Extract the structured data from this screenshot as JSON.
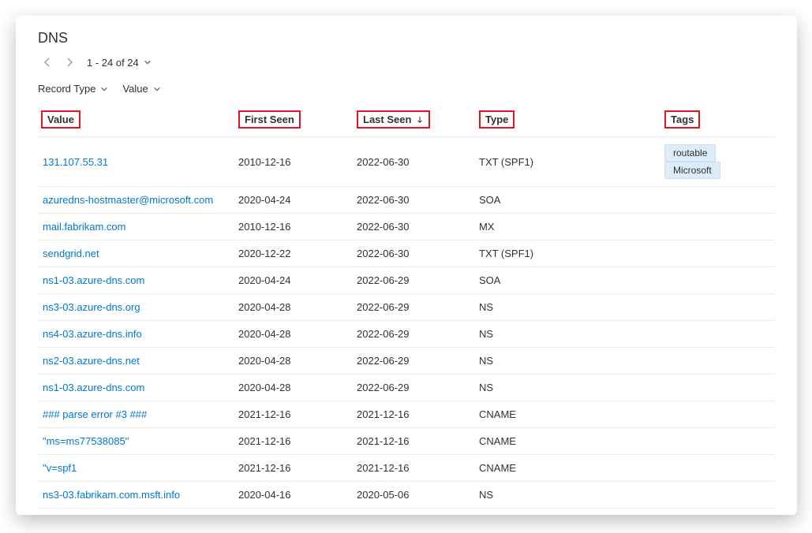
{
  "title": "DNS",
  "pager": {
    "range_text": "1 - 24 of 24"
  },
  "filters": [
    {
      "label": "Record Type"
    },
    {
      "label": "Value"
    }
  ],
  "columns": {
    "value": "Value",
    "first_seen": "First Seen",
    "last_seen": "Last Seen",
    "type": "Type",
    "tags": "Tags"
  },
  "sort": {
    "column": "last_seen",
    "direction": "desc"
  },
  "rows": [
    {
      "value": "131.107.55.31",
      "first_seen": "2010-12-16",
      "last_seen": "2022-06-30",
      "type": "TXT (SPF1)",
      "tags": [
        "routable",
        "Microsoft"
      ]
    },
    {
      "value": "azuredns-hostmaster@microsoft.com",
      "first_seen": "2020-04-24",
      "last_seen": "2022-06-30",
      "type": "SOA",
      "tags": []
    },
    {
      "value": "mail.fabrikam.com",
      "first_seen": "2010-12-16",
      "last_seen": "2022-06-30",
      "type": "MX",
      "tags": []
    },
    {
      "value": "sendgrid.net",
      "first_seen": "2020-12-22",
      "last_seen": "2022-06-30",
      "type": "TXT (SPF1)",
      "tags": []
    },
    {
      "value": "ns1-03.azure-dns.com",
      "first_seen": "2020-04-24",
      "last_seen": "2022-06-29",
      "type": "SOA",
      "tags": []
    },
    {
      "value": "ns3-03.azure-dns.org",
      "first_seen": "2020-04-28",
      "last_seen": "2022-06-29",
      "type": "NS",
      "tags": []
    },
    {
      "value": "ns4-03.azure-dns.info",
      "first_seen": "2020-04-28",
      "last_seen": "2022-06-29",
      "type": "NS",
      "tags": []
    },
    {
      "value": "ns2-03.azure-dns.net",
      "first_seen": "2020-04-28",
      "last_seen": "2022-06-29",
      "type": "NS",
      "tags": []
    },
    {
      "value": "ns1-03.azure-dns.com",
      "first_seen": "2020-04-28",
      "last_seen": "2022-06-29",
      "type": "NS",
      "tags": []
    },
    {
      "value": "### parse error #3 ###",
      "first_seen": "2021-12-16",
      "last_seen": "2021-12-16",
      "type": "CNAME",
      "tags": []
    },
    {
      "value": "\"ms=ms77538085\"",
      "first_seen": "2021-12-16",
      "last_seen": "2021-12-16",
      "type": "CNAME",
      "tags": []
    },
    {
      "value": "\"v=spf1",
      "first_seen": "2021-12-16",
      "last_seen": "2021-12-16",
      "type": "CNAME",
      "tags": []
    },
    {
      "value": "ns3-03.fabrikam.com.msft.info",
      "first_seen": "2020-04-16",
      "last_seen": "2020-05-06",
      "type": "NS",
      "tags": []
    }
  ],
  "colors": {
    "link": "#0078d4",
    "tag_bg": "#deecf9",
    "highlight_border": "#e81123"
  }
}
